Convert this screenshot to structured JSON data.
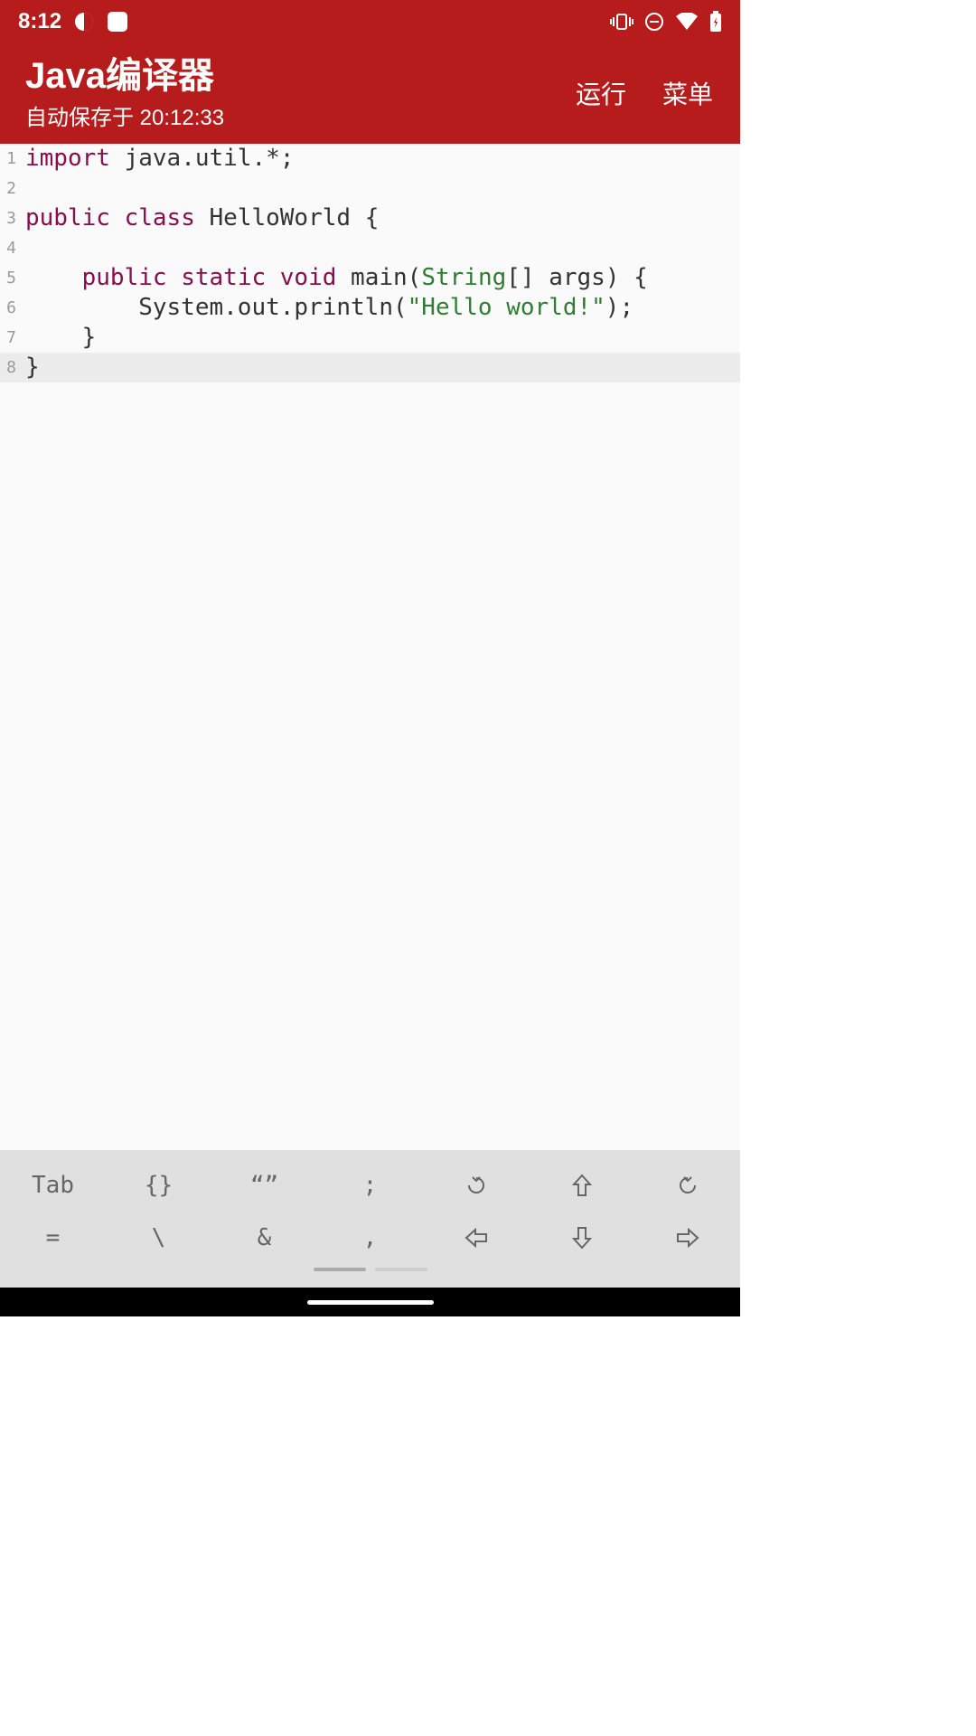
{
  "status": {
    "time": "8:12"
  },
  "header": {
    "title": "Java编译器",
    "subtitle": "自动保存于 20:12:33",
    "run_label": "运行",
    "menu_label": "菜单"
  },
  "code": {
    "lines": [
      {
        "n": "1",
        "type": "tokens",
        "tokens": [
          [
            "kw",
            "import"
          ],
          [
            "",
            " java.util.*;"
          ]
        ]
      },
      {
        "n": "2",
        "type": "plain",
        "text": ""
      },
      {
        "n": "3",
        "type": "tokens",
        "tokens": [
          [
            "kw",
            "public"
          ],
          [
            "",
            " "
          ],
          [
            "kw",
            "class"
          ],
          [
            "",
            " HelloWorld {"
          ]
        ]
      },
      {
        "n": "4",
        "type": "plain",
        "text": ""
      },
      {
        "n": "5",
        "type": "tokens",
        "tokens": [
          [
            "",
            "    "
          ],
          [
            "kw",
            "public"
          ],
          [
            "",
            " "
          ],
          [
            "kw",
            "static"
          ],
          [
            "",
            " "
          ],
          [
            "kw",
            "void"
          ],
          [
            "",
            " main("
          ],
          [
            "type",
            "String"
          ],
          [
            "",
            "[] args) {"
          ]
        ]
      },
      {
        "n": "6",
        "type": "tokens",
        "tokens": [
          [
            "",
            "        System.out.println("
          ],
          [
            "str",
            "\"Hello world!\""
          ],
          [
            "",
            ");"
          ]
        ]
      },
      {
        "n": "7",
        "type": "plain",
        "text": "    }"
      },
      {
        "n": "8",
        "type": "plain",
        "text": "}",
        "current": true
      }
    ]
  },
  "toolbar": {
    "row1": [
      "Tab",
      "{}",
      "“”",
      ";",
      "undo-icon",
      "up-icon",
      "redo-icon"
    ],
    "row2": [
      "=",
      "\\",
      "&",
      ",",
      "left-icon",
      "down-icon",
      "right-icon"
    ]
  }
}
